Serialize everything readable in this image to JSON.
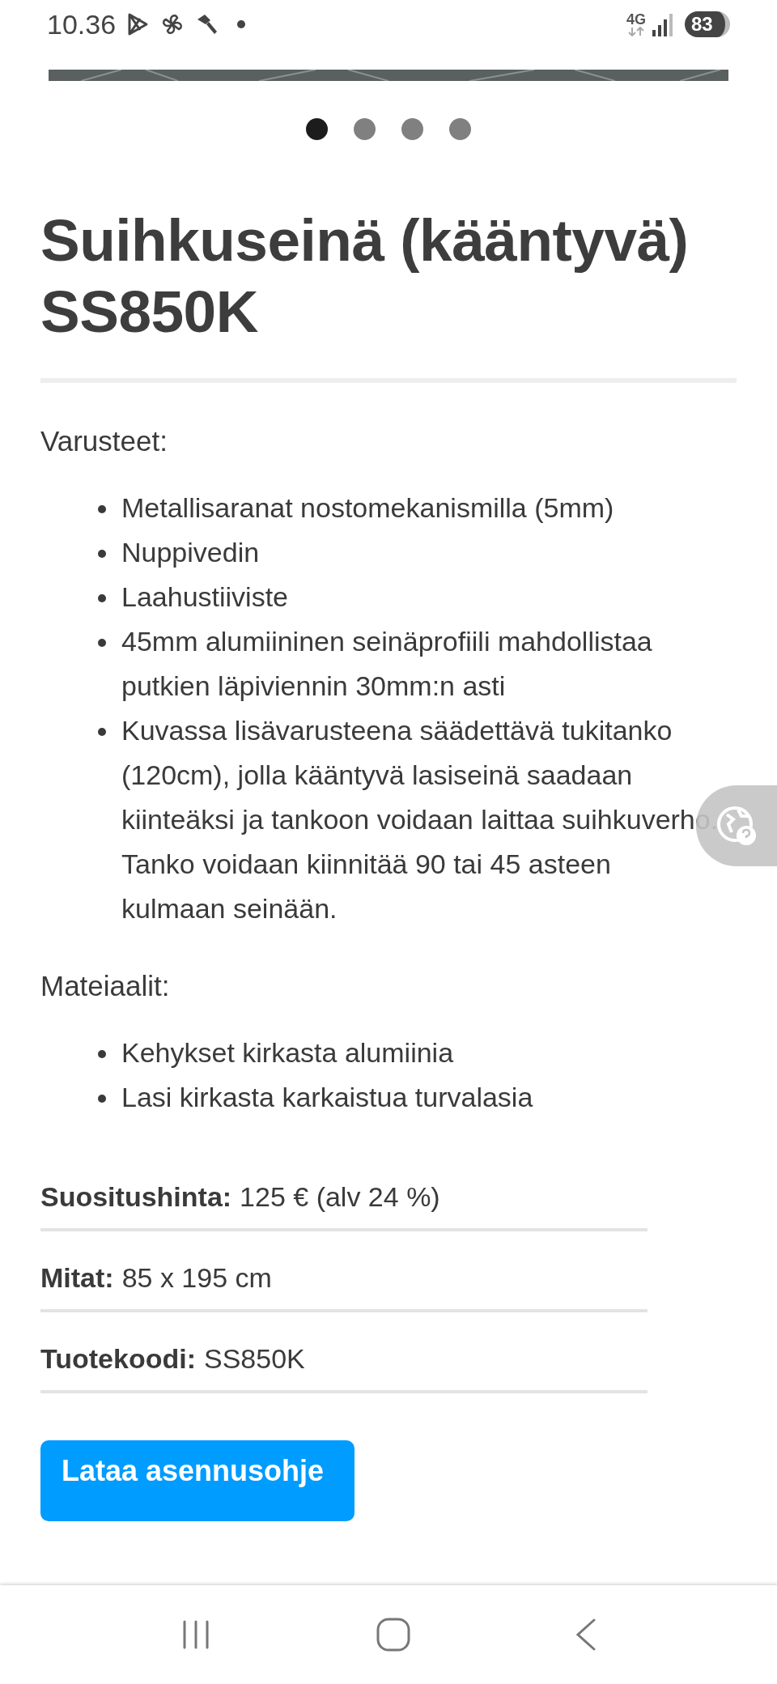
{
  "status_bar": {
    "time": "10.36",
    "network": "4G",
    "battery": "83"
  },
  "carousel": {
    "dots": [
      {
        "selected": true
      },
      {
        "selected": false
      },
      {
        "selected": false
      },
      {
        "selected": false
      }
    ]
  },
  "title": "Suihkuseinä (kääntyvä) SS850K",
  "sections": [
    {
      "heading": "Varusteet:",
      "items": [
        "Metallisaranat nostomekanismilla (5mm)",
        "Nuppivedin",
        "Laahustiiviste",
        "45mm alumiininen seinäprofiili mahdollistaa putkien läpiviennin 30mm:n asti",
        "Kuvassa lisävarusteena säädettävä tukitanko (120cm), jolla kääntyvä lasiseinä saadaan kiinteäksi ja tankoon voidaan laittaa suihkuverho. Tanko voidaan kiinnitää 90 tai 45 asteen kulmaan seinään."
      ]
    },
    {
      "heading": "Mateiaalit:",
      "items": [
        "Kehykset kirkasta alumiinia",
        "Lasi kirkasta karkaistua turvalasia"
      ]
    }
  ],
  "specs": [
    {
      "label": "Suositushinta:",
      "value": "125 € (alv 24 %)"
    },
    {
      "label": "Mitat:",
      "value": "85 x 195 cm"
    },
    {
      "label": "Tuotekoodi:",
      "value": "SS850K"
    }
  ],
  "download_button": "Lataa asennusohje"
}
